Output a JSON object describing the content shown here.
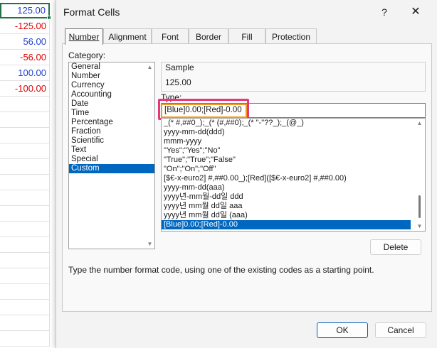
{
  "sheet": {
    "cells": [
      {
        "value": "125.00",
        "color": "#1f3fcf",
        "selected": true
      },
      {
        "value": "-125.00",
        "color": "#e00000"
      },
      {
        "value": "56.00",
        "color": "#1f3fcf"
      },
      {
        "value": "-56.00",
        "color": "#e00000"
      },
      {
        "value": "100.00",
        "color": "#1f3fcf"
      },
      {
        "value": "-100.00",
        "color": "#e00000"
      }
    ]
  },
  "dialog": {
    "title": "Format Cells",
    "help_label": "?",
    "close_label": "✕",
    "tabs": [
      "Number",
      "Alignment",
      "Font",
      "Border",
      "Fill",
      "Protection"
    ],
    "active_tab": "Number",
    "category_label": "Category:",
    "categories": [
      "General",
      "Number",
      "Currency",
      "Accounting",
      "Date",
      "Time",
      "Percentage",
      "Fraction",
      "Scientific",
      "Text",
      "Special",
      "Custom"
    ],
    "selected_category": "Custom",
    "sample_label": "Sample",
    "sample_value": "125.00",
    "type_label": "Type:",
    "type_value": "[Blue]0.00;[Red]-0.00",
    "formats": [
      "_(* #,##0_);_(* (#,##0);_(* \"-\"??_);_(@_)",
      "yyyy-mm-dd(ddd)",
      "mmm-yyyy",
      "\"Yes\";\"Yes\";\"No\"",
      "\"True\";\"True\";\"False\"",
      "\"On\";\"On\";\"Off\"",
      "[$€-x-euro2] #,##0.00_);[Red]([$€-x-euro2] #,##0.00)",
      "yyyy-mm-dd(aaa)",
      "yyyy년-mm월-dd일 ddd",
      "yyyy년 mm월 dd일 aaa",
      "yyyy년 mm월 dd일 (aaa)",
      "[Blue]0.00;[Red]-0.00"
    ],
    "selected_format": "[Blue]0.00;[Red]-0.00",
    "delete_label": "Delete",
    "description": "Type the number format code, using one of the existing codes as a starting point.",
    "ok_label": "OK",
    "cancel_label": "Cancel",
    "highlight_colors": {
      "outer": "#e6377d",
      "inner": "#ef9a1c"
    }
  }
}
